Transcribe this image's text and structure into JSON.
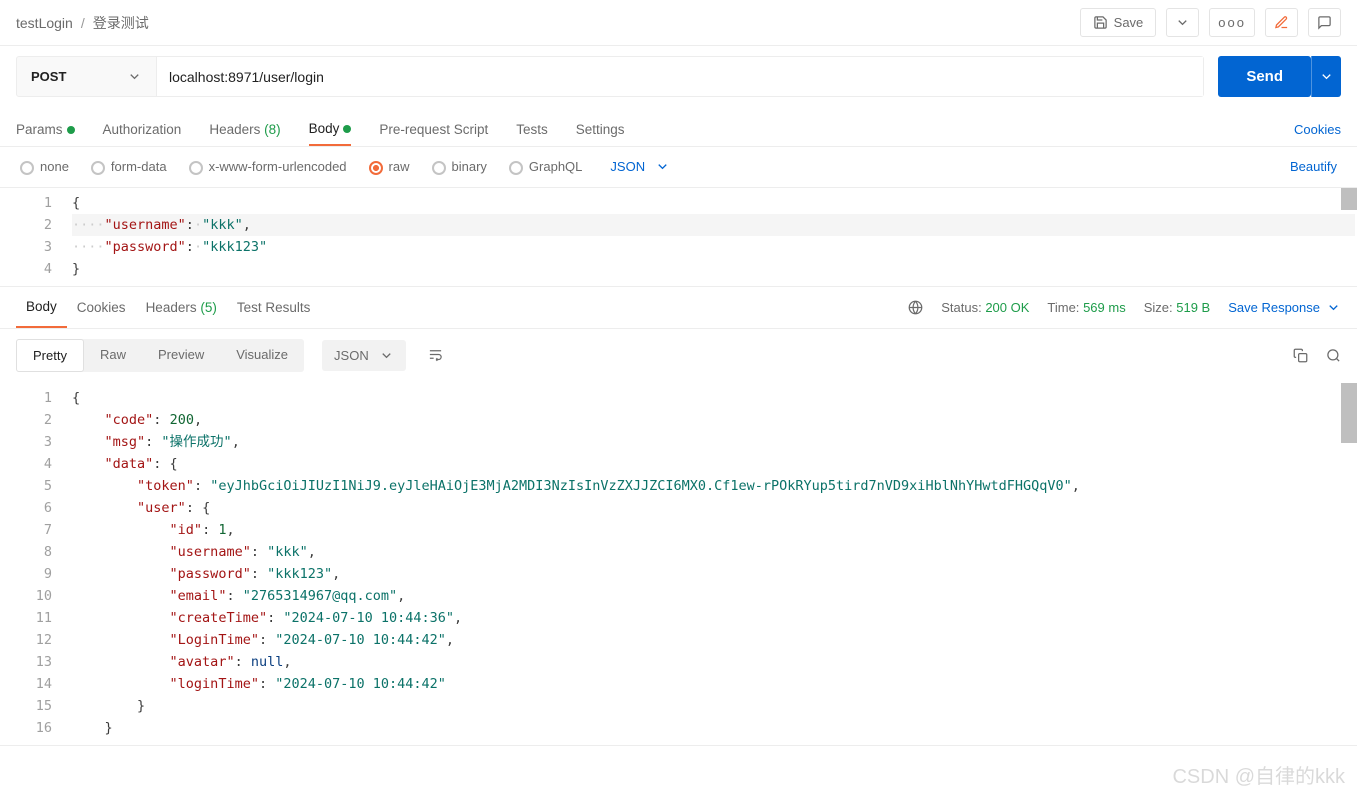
{
  "breadcrumb": {
    "collection": "testLogin",
    "name": "登录测试"
  },
  "topbar": {
    "save": "Save"
  },
  "request": {
    "method": "POST",
    "url": "localhost:8971/user/login",
    "send": "Send"
  },
  "reqTabs": {
    "params": "Params",
    "authorization": "Authorization",
    "headers": "Headers",
    "headers_count": "(8)",
    "body": "Body",
    "prerequest": "Pre-request Script",
    "tests": "Tests",
    "settings": "Settings",
    "cookies": "Cookies"
  },
  "bodyTypes": {
    "none": "none",
    "formdata": "form-data",
    "xwww": "x-www-form-urlencoded",
    "raw": "raw",
    "binary": "binary",
    "graphql": "GraphQL",
    "json": "JSON",
    "beautify": "Beautify"
  },
  "reqBody": {
    "l1": "{",
    "k_user": "\"username\"",
    "v_user": "\"kkk\"",
    "k_pass": "\"password\"",
    "v_pass": "\"kkk123\"",
    "l4": "}"
  },
  "respTabs": {
    "body": "Body",
    "cookies": "Cookies",
    "headers": "Headers",
    "headers_count": "(5)",
    "testResults": "Test Results"
  },
  "status": {
    "statusLabel": "Status:",
    "statusValue": "200 OK",
    "timeLabel": "Time:",
    "timeValue": "569 ms",
    "sizeLabel": "Size:",
    "sizeValue": "519 B",
    "saveResponse": "Save Response"
  },
  "view": {
    "pretty": "Pretty",
    "raw": "Raw",
    "preview": "Preview",
    "visualize": "Visualize",
    "json": "JSON"
  },
  "respBody": {
    "code_k": "\"code\"",
    "code_v": "200",
    "msg_k": "\"msg\"",
    "msg_v": "\"操作成功\"",
    "data_k": "\"data\"",
    "token_k": "\"token\"",
    "token_v": "\"eyJhbGciOiJIUzI1NiJ9.eyJleHAiOjE3MjA2MDI3NzIsInVzZXJJZCI6MX0.Cf1ew-rPOkRYup5tird7nVD9xiHblNhYHwtdFHGQqV0\"",
    "user_k": "\"user\"",
    "id_k": "\"id\"",
    "id_v": "1",
    "username_k": "\"username\"",
    "username_v": "\"kkk\"",
    "password_k": "\"password\"",
    "password_v": "\"kkk123\"",
    "email_k": "\"email\"",
    "email_v": "\"2765314967@qq.com\"",
    "createTime_k": "\"createTime\"",
    "createTime_v": "\"2024-07-10 10:44:36\"",
    "LoginTime_k": "\"LoginTime\"",
    "LoginTime_v": "\"2024-07-10 10:44:42\"",
    "avatar_k": "\"avatar\"",
    "avatar_v": "null",
    "loginTime_k": "\"loginTime\"",
    "loginTime_v": "\"2024-07-10 10:44:42\""
  },
  "watermark": "CSDN @自律的kkk"
}
